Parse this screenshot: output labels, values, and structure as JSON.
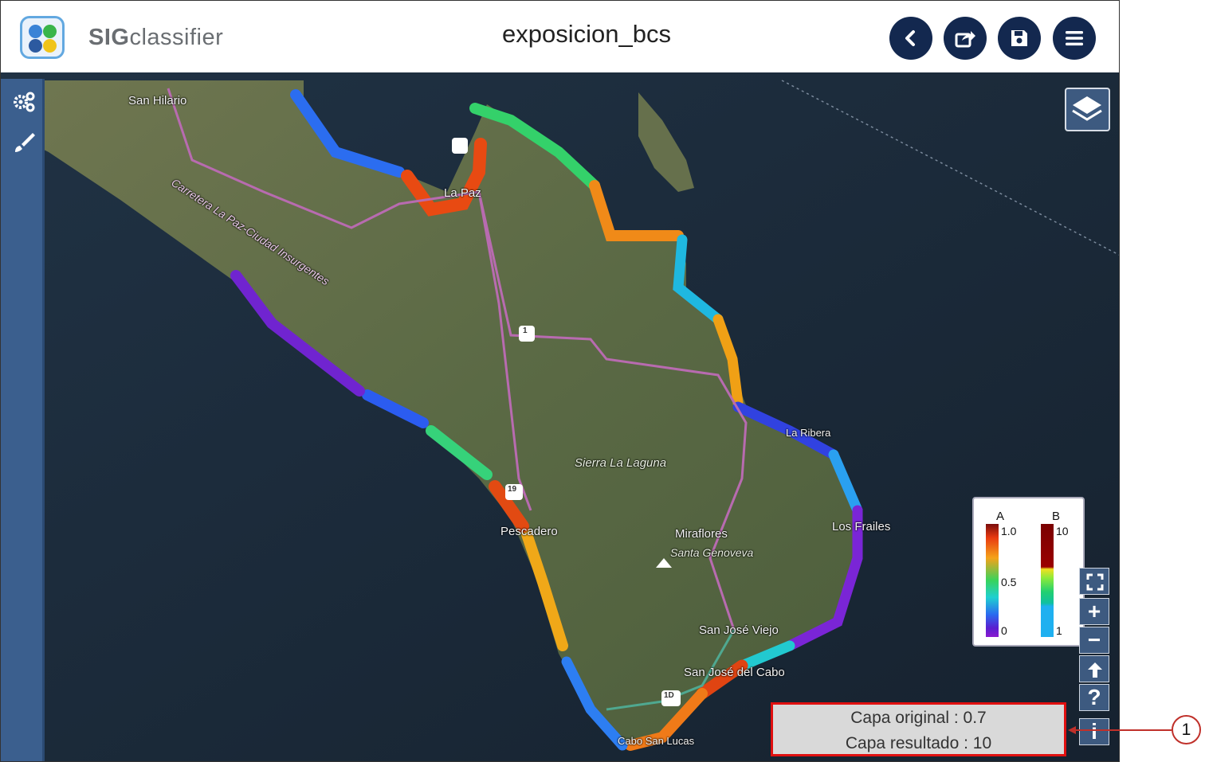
{
  "header": {
    "app_name_bold": "SIG",
    "app_name_rest": "classifier",
    "document_title": "exposicion_bcs",
    "buttons": [
      "back-icon",
      "export-icon",
      "save-icon",
      "menu-icon"
    ]
  },
  "left_toolbar": {
    "tools": [
      "settings-gears-icon",
      "paint-brush-icon"
    ]
  },
  "map": {
    "layers_button_icon": "layers-icon",
    "places": {
      "san_hilario": "San Hilario",
      "carretera": "Carretera La Paz-Ciudad Insurgentes",
      "la_paz": "La Paz",
      "sierra": "Sierra La Laguna",
      "pescadero": "Pescadero",
      "miraflores": "Miraflores",
      "santa_genoveva": "Santa Genoveva",
      "los_frailes": "Los Frailes",
      "san_jose_viejo": "San José Viejo",
      "san_jose_cabo": "San José del Cabo",
      "cabo_lucas": "Cabo San Lucas",
      "la_ribera": "La Ribera"
    },
    "highways": [
      "1",
      "19",
      "1D"
    ]
  },
  "legend": {
    "col_a": {
      "title": "A",
      "top": "1.0",
      "mid": "0.5",
      "bottom": "0"
    },
    "col_b": {
      "title": "B",
      "top": "10",
      "bottom": "1"
    }
  },
  "map_controls": [
    "fullscreen-icon",
    "+",
    "−",
    "up-arrow-icon",
    "?",
    "i"
  ],
  "info_panel": {
    "original": "Capa original : 0.7",
    "result": "Capa resultado : 10"
  },
  "annotation": {
    "number": "1",
    "color": "#c0302a"
  },
  "colors": {
    "header_button": "#13284f",
    "toolbar": "#3b5f8e",
    "highlight_border": "#e01010"
  }
}
